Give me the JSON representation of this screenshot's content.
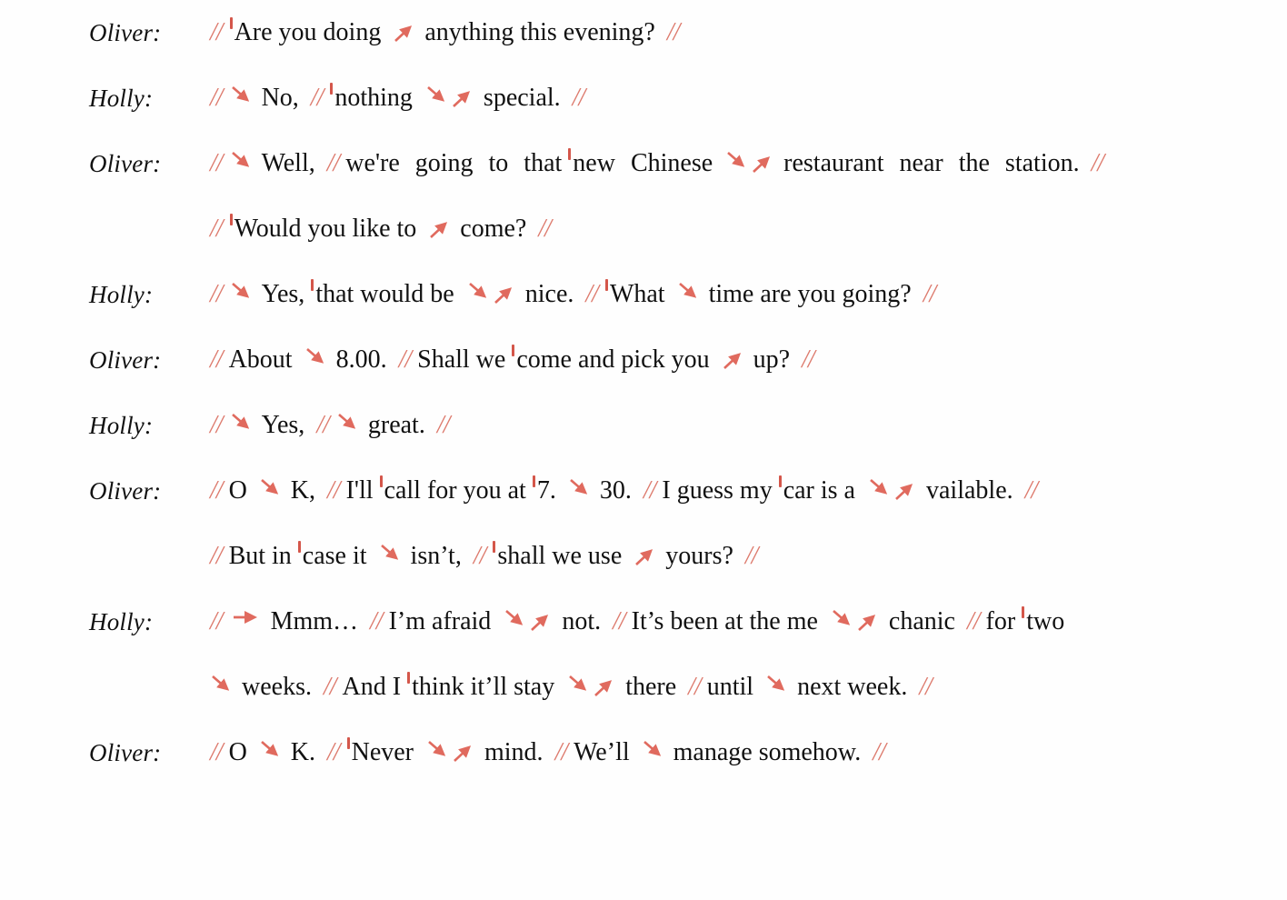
{
  "meta": {
    "doc_type": "intonation-marked dialogue transcript",
    "mark_color": "#e06a5e",
    "text_color": "#111111",
    "background": "#ffffff",
    "boundary_symbol": "//",
    "stress_symbol": "ˈ",
    "tone_symbols": {
      "fall": "↘",
      "rise": "↗",
      "fall-rise": "↘↗",
      "level": "→"
    }
  },
  "speakers": {
    "a": "Oliver:",
    "b": "Holly:"
  },
  "turns": [
    {
      "speaker": "Oliver:",
      "lines": [
        {
          "tokens": [
            {
              "t": "bound",
              "v": "//"
            },
            {
              "t": "stress"
            },
            {
              "t": "text",
              "v": "Are you doing"
            },
            {
              "t": "rise"
            },
            {
              "t": "text",
              "v": "anything this evening?"
            },
            {
              "t": "bound",
              "v": "//"
            }
          ],
          "plain": "// ˈAre you doing ↗ anything this evening? //"
        }
      ]
    },
    {
      "speaker": "Holly:",
      "lines": [
        {
          "tokens": [
            {
              "t": "bound",
              "v": "//"
            },
            {
              "t": "fall"
            },
            {
              "t": "text",
              "v": "No,"
            },
            {
              "t": "bound",
              "v": "//"
            },
            {
              "t": "stress"
            },
            {
              "t": "text",
              "v": "nothing"
            },
            {
              "t": "fallrise"
            },
            {
              "t": "text",
              "v": "special."
            },
            {
              "t": "bound",
              "v": "//"
            }
          ],
          "plain": "// ↘ No, // ˈnothing ↘↗ special. //"
        }
      ]
    },
    {
      "speaker": "Oliver:",
      "lines": [
        {
          "justify": true,
          "tokens": [
            {
              "t": "bound",
              "v": "//"
            },
            {
              "t": "fall"
            },
            {
              "t": "text",
              "v": "Well,"
            },
            {
              "t": "bound",
              "v": "//"
            },
            {
              "t": "text",
              "v": "we're going to that"
            },
            {
              "t": "stress"
            },
            {
              "t": "text",
              "v": "new Chinese"
            },
            {
              "t": "fallrise"
            },
            {
              "t": "text",
              "v": "restaurant near the station."
            },
            {
              "t": "bound",
              "v": "//"
            }
          ],
          "plain": "// ↘ Well, // we're going to that ˈnew Chinese ↘↗ restaurant near the station. //"
        },
        {
          "tokens": [
            {
              "t": "bound",
              "v": "//"
            },
            {
              "t": "stress"
            },
            {
              "t": "text",
              "v": "Would you like to"
            },
            {
              "t": "rise"
            },
            {
              "t": "text",
              "v": "come?"
            },
            {
              "t": "bound",
              "v": "//"
            }
          ],
          "plain": "// ˈWould you like to ↗ come? //"
        }
      ]
    },
    {
      "speaker": "Holly:",
      "lines": [
        {
          "tokens": [
            {
              "t": "bound",
              "v": "//"
            },
            {
              "t": "fall"
            },
            {
              "t": "text",
              "v": "Yes,"
            },
            {
              "t": "stress"
            },
            {
              "t": "text",
              "v": "that would be"
            },
            {
              "t": "fallrise"
            },
            {
              "t": "text",
              "v": "nice."
            },
            {
              "t": "bound",
              "v": "//"
            },
            {
              "t": "stress"
            },
            {
              "t": "text",
              "v": "What"
            },
            {
              "t": "fall"
            },
            {
              "t": "text",
              "v": "time are you going?"
            },
            {
              "t": "bound",
              "v": "//"
            }
          ],
          "plain": "// ↘ Yes, ˈthat would be ↘↗ nice. // ˈWhat ↘ time are you going? //"
        }
      ]
    },
    {
      "speaker": "Oliver:",
      "lines": [
        {
          "tokens": [
            {
              "t": "bound",
              "v": "//"
            },
            {
              "t": "text",
              "v": "About"
            },
            {
              "t": "fall"
            },
            {
              "t": "text",
              "v": "8.00."
            },
            {
              "t": "bound",
              "v": "//"
            },
            {
              "t": "text",
              "v": "Shall we"
            },
            {
              "t": "stress"
            },
            {
              "t": "text",
              "v": "come and pick you"
            },
            {
              "t": "rise"
            },
            {
              "t": "text",
              "v": "up?"
            },
            {
              "t": "bound",
              "v": "//"
            }
          ],
          "plain": "// About ↘ 8.00. // Shall we ˈcome and pick you ↗ up? //"
        }
      ]
    },
    {
      "speaker": "Holly:",
      "lines": [
        {
          "tokens": [
            {
              "t": "bound",
              "v": "//"
            },
            {
              "t": "fall"
            },
            {
              "t": "text",
              "v": "Yes,"
            },
            {
              "t": "bound",
              "v": "//"
            },
            {
              "t": "fall"
            },
            {
              "t": "text",
              "v": "great."
            },
            {
              "t": "bound",
              "v": "//"
            }
          ],
          "plain": "// ↘ Yes, // ↘ great. //"
        }
      ]
    },
    {
      "speaker": "Oliver:",
      "lines": [
        {
          "tokens": [
            {
              "t": "bound",
              "v": "//"
            },
            {
              "t": "text",
              "v": "O"
            },
            {
              "t": "fall"
            },
            {
              "t": "text",
              "v": "K,"
            },
            {
              "t": "bound",
              "v": "//"
            },
            {
              "t": "text",
              "v": "I'll"
            },
            {
              "t": "stress"
            },
            {
              "t": "text",
              "v": "call for you at"
            },
            {
              "t": "stress"
            },
            {
              "t": "text",
              "v": "7."
            },
            {
              "t": "fall"
            },
            {
              "t": "text",
              "v": "30."
            },
            {
              "t": "bound",
              "v": "//"
            },
            {
              "t": "text",
              "v": "I guess my"
            },
            {
              "t": "stress"
            },
            {
              "t": "text",
              "v": "car is a"
            },
            {
              "t": "fallrise"
            },
            {
              "t": "text",
              "v": "vailable."
            },
            {
              "t": "bound",
              "v": "//"
            }
          ],
          "plain": "// O ↘ K, // I'll ˈcall for you at ˈ7. ↘ 30. // I guess my ˈcar is a ↘↗ vailable. //"
        },
        {
          "tokens": [
            {
              "t": "bound",
              "v": "//"
            },
            {
              "t": "text",
              "v": "But in"
            },
            {
              "t": "stress"
            },
            {
              "t": "text",
              "v": "case it"
            },
            {
              "t": "fall"
            },
            {
              "t": "text",
              "v": "isn’t,"
            },
            {
              "t": "bound",
              "v": "//"
            },
            {
              "t": "stress"
            },
            {
              "t": "text",
              "v": "shall we use"
            },
            {
              "t": "rise"
            },
            {
              "t": "text",
              "v": "yours?"
            },
            {
              "t": "bound",
              "v": "//"
            }
          ],
          "plain": "// But in ˈcase it ↘ isn’t, // ˈshall we use ↗ yours? //"
        }
      ]
    },
    {
      "speaker": "Holly:",
      "lines": [
        {
          "tokens": [
            {
              "t": "bound",
              "v": "//"
            },
            {
              "t": "level"
            },
            {
              "t": "text",
              "v": "Mmm…"
            },
            {
              "t": "bound",
              "v": "//"
            },
            {
              "t": "text",
              "v": "I’m afraid"
            },
            {
              "t": "fallrise"
            },
            {
              "t": "text",
              "v": "not."
            },
            {
              "t": "bound",
              "v": "//"
            },
            {
              "t": "text",
              "v": "It’s been at the me"
            },
            {
              "t": "fallrise"
            },
            {
              "t": "text",
              "v": "chanic"
            },
            {
              "t": "bound",
              "v": "//"
            },
            {
              "t": "text",
              "v": "for"
            },
            {
              "t": "stress"
            },
            {
              "t": "text",
              "v": "two"
            }
          ],
          "plain": "// → Mmm…// I’m afraid ↘↗ not. // It’s been at the me ↘↗ chanic // for ˈtwo"
        },
        {
          "tokens": [
            {
              "t": "fall"
            },
            {
              "t": "text",
              "v": "weeks."
            },
            {
              "t": "bound",
              "v": "//"
            },
            {
              "t": "text",
              "v": "And I"
            },
            {
              "t": "stress"
            },
            {
              "t": "text",
              "v": "think it’ll stay"
            },
            {
              "t": "fallrise"
            },
            {
              "t": "text",
              "v": "there"
            },
            {
              "t": "bound",
              "v": "//"
            },
            {
              "t": "text",
              "v": "until"
            },
            {
              "t": "fall"
            },
            {
              "t": "text",
              "v": "next week."
            },
            {
              "t": "bound",
              "v": "//"
            }
          ],
          "plain": "↘ weeks. // And I ˈthink it’ll stay ↘↗ there // until ↘ next week. //"
        }
      ]
    },
    {
      "speaker": "Oliver:",
      "lines": [
        {
          "tokens": [
            {
              "t": "bound",
              "v": "//"
            },
            {
              "t": "text",
              "v": "O"
            },
            {
              "t": "fall"
            },
            {
              "t": "text",
              "v": "K."
            },
            {
              "t": "bound",
              "v": "//"
            },
            {
              "t": "stress"
            },
            {
              "t": "text",
              "v": "Never"
            },
            {
              "t": "fallrise"
            },
            {
              "t": "text",
              "v": "mind."
            },
            {
              "t": "bound",
              "v": "//"
            },
            {
              "t": "text",
              "v": "We’ll"
            },
            {
              "t": "fall"
            },
            {
              "t": "text",
              "v": "manage somehow."
            },
            {
              "t": "bound",
              "v": "//"
            }
          ],
          "plain": "// O ↘ K. // ˈNever ↘↗ mind. // We’ll ↘ manage somehow. //"
        }
      ]
    }
  ]
}
